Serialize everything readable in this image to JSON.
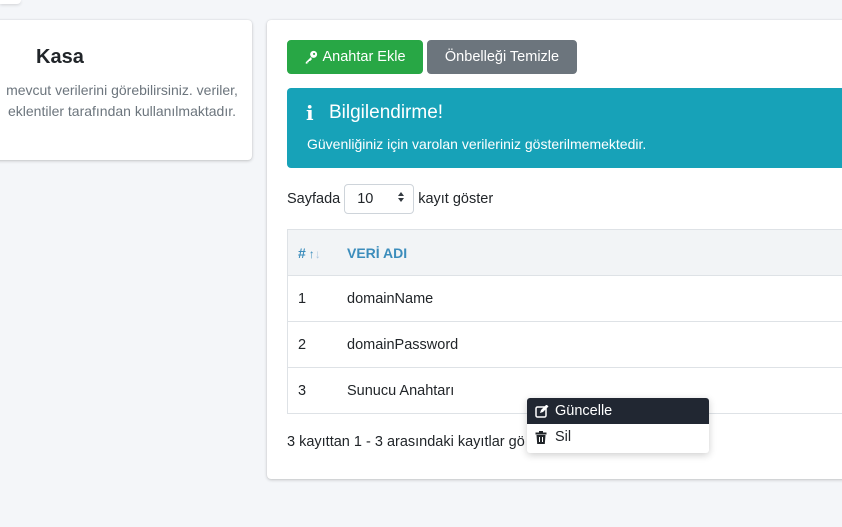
{
  "sidebar_card": {
    "title": "Kasa",
    "description": "mevcut verilerini görebilirsiniz. veriler, eklentiler tarafından kullanılmaktadır."
  },
  "toolbar": {
    "add_key_label": "Anahtar Ekle",
    "clear_cache_label": "Önbelleği Temizle"
  },
  "alert": {
    "title": "Bilgilendirme!",
    "text": "Güvenliğiniz için varolan verileriniz gösterilmemektedir."
  },
  "length_menu": {
    "prefix": "Sayfada",
    "value": "10",
    "suffix": "kayıt göster"
  },
  "table": {
    "columns": [
      "#",
      "VERİ ADI"
    ],
    "rows": [
      {
        "id": "1",
        "name": "domainName"
      },
      {
        "id": "2",
        "name": "domainPassword"
      },
      {
        "id": "3",
        "name": "Sunucu Anahtarı"
      }
    ]
  },
  "info": "3 kayıttan 1 - 3 arasındaki kayıtlar gö",
  "context_menu": {
    "items": [
      {
        "label": "Güncelle",
        "icon": "edit-icon"
      },
      {
        "label": "Sil",
        "icon": "trash-icon"
      }
    ]
  },
  "colors": {
    "success": "#28a745",
    "secondary": "#6c757d",
    "info": "#17a2b8",
    "link": "#3c8dbc",
    "menu_active": "#212732"
  }
}
